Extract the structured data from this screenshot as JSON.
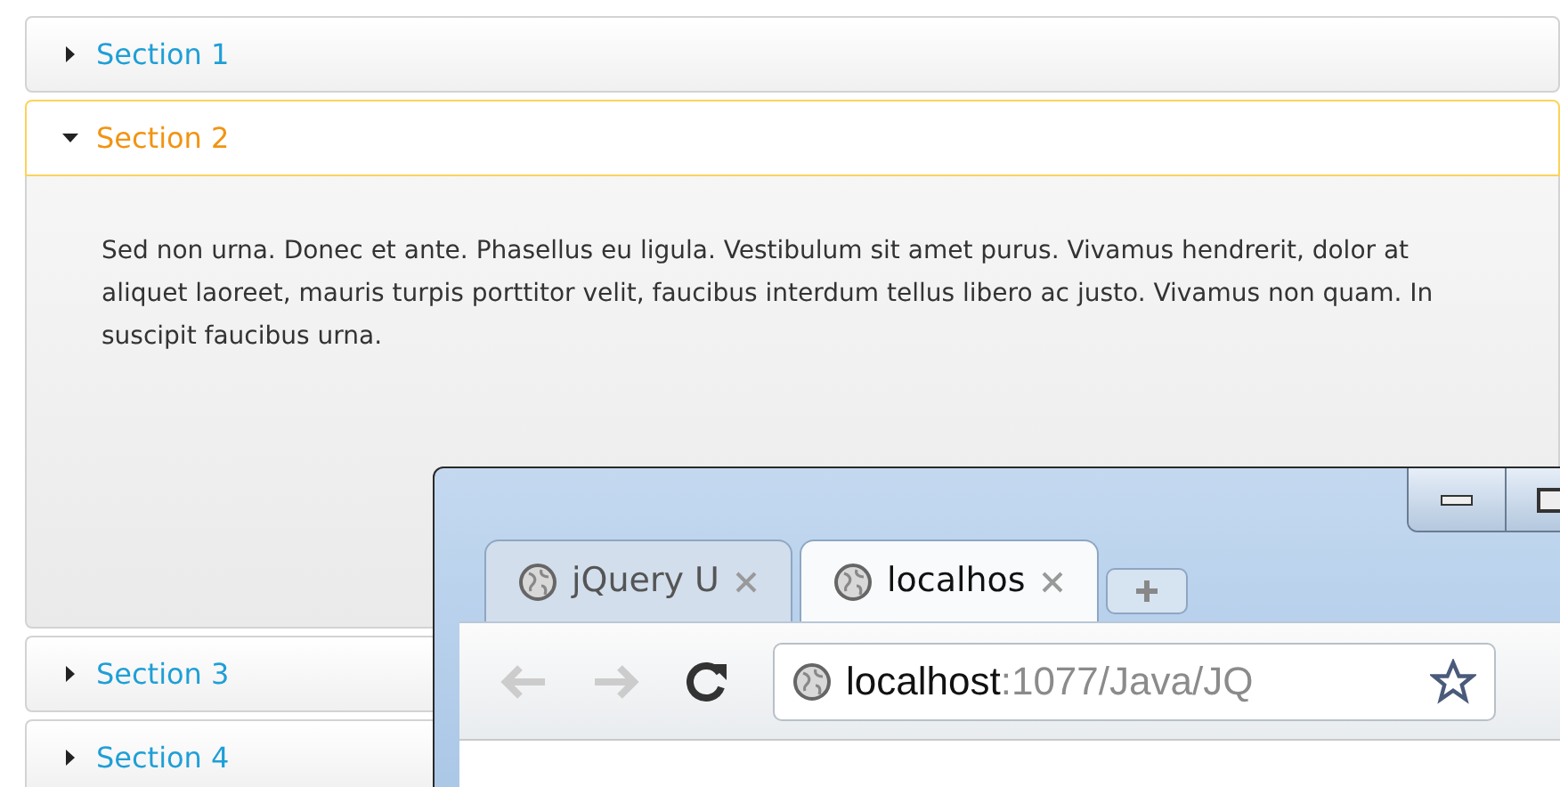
{
  "accordion": {
    "sections": [
      {
        "title": "Section 1",
        "expanded": false
      },
      {
        "title": "Section 2",
        "expanded": true,
        "content": "Sed non urna. Donec et ante. Phasellus eu ligula. Vestibulum sit amet purus. Vivamus hendrerit, dolor at aliquet laoreet, mauris turpis porttitor velit, faucibus interdum tellus libero ac justo. Vivamus non quam. In suscipit faucibus urna."
      },
      {
        "title": "Section 3",
        "expanded": false
      },
      {
        "title": "Section 4",
        "expanded": false
      }
    ]
  },
  "browser": {
    "tabs": [
      {
        "title": "jQuery U",
        "selected": false
      },
      {
        "title": "localhos",
        "selected": true
      }
    ],
    "address": {
      "host": "localhost",
      "path": ":1077/Java/JQ"
    }
  }
}
